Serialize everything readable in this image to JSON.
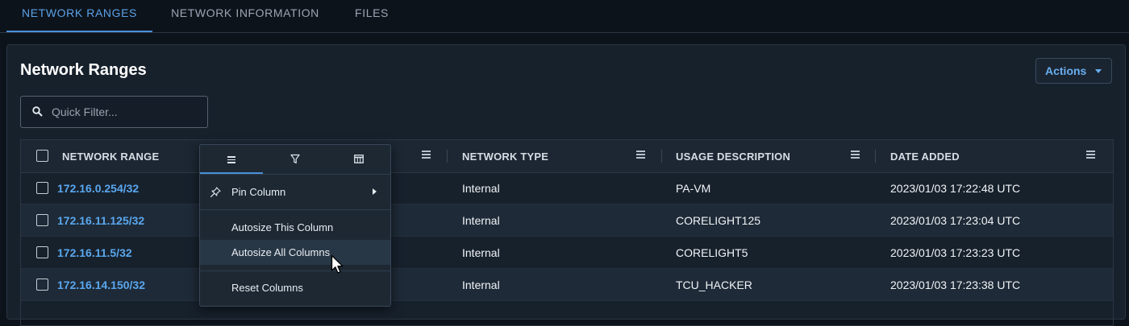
{
  "tabs": [
    {
      "label": "NETWORK RANGES"
    },
    {
      "label": "NETWORK INFORMATION"
    },
    {
      "label": "FILES"
    }
  ],
  "panel": {
    "title": "Network Ranges",
    "actions_label": "Actions",
    "search": {
      "placeholder": "Quick Filter..."
    }
  },
  "columns": [
    {
      "label": "NETWORK RANGE"
    },
    {
      "label": "NETWORK TYPE"
    },
    {
      "label": "USAGE DESCRIPTION"
    },
    {
      "label": "DATE ADDED"
    }
  ],
  "rows": [
    {
      "range": "172.16.0.254/32",
      "type": "Internal",
      "usage": "PA-VM",
      "date": "2023/01/03 17:22:48 UTC"
    },
    {
      "range": "172.16.11.125/32",
      "type": "Internal",
      "usage": "CORELIGHT125",
      "date": "2023/01/03 17:23:04 UTC"
    },
    {
      "range": "172.16.11.5/32",
      "type": "Internal",
      "usage": "CORELIGHT5",
      "date": "2023/01/03 17:23:23 UTC"
    },
    {
      "range": "172.16.14.150/32",
      "type": "Internal",
      "usage": "TCU_HACKER",
      "date": "2023/01/03 17:23:38 UTC"
    }
  ],
  "column_menu": {
    "tabs": [
      {
        "icon": "menu-icon"
      },
      {
        "icon": "filter-icon"
      },
      {
        "icon": "columns-icon"
      }
    ],
    "items": [
      {
        "label": "Pin Column",
        "icon": "pin-icon",
        "submenu": true
      },
      {
        "label": "Autosize This Column"
      },
      {
        "label": "Autosize All Columns",
        "highlighted": true
      },
      {
        "label": "Reset Columns"
      }
    ]
  },
  "colors": {
    "accent": "#4a8fd6",
    "link": "#5aa7ee",
    "background": "#0d131b",
    "panel": "#17212c"
  }
}
